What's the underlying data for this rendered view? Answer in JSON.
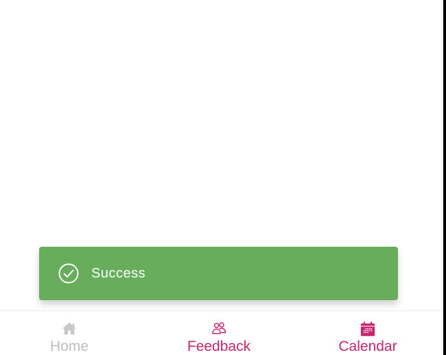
{
  "colors": {
    "toast_background": "#67ad5b",
    "accent": "#c8256f",
    "inactive": "#c7c7c7",
    "inactive_label": "#bdbdbd"
  },
  "toast": {
    "icon": "check-circle-icon",
    "message": "Success"
  },
  "tabbar": {
    "tabs": [
      {
        "label": "Home",
        "icon": "home-icon",
        "active": false
      },
      {
        "label": "Feedback",
        "icon": "people-icon",
        "active": true
      },
      {
        "label": "Calendar",
        "icon": "calendar-icon",
        "active": true
      }
    ]
  }
}
